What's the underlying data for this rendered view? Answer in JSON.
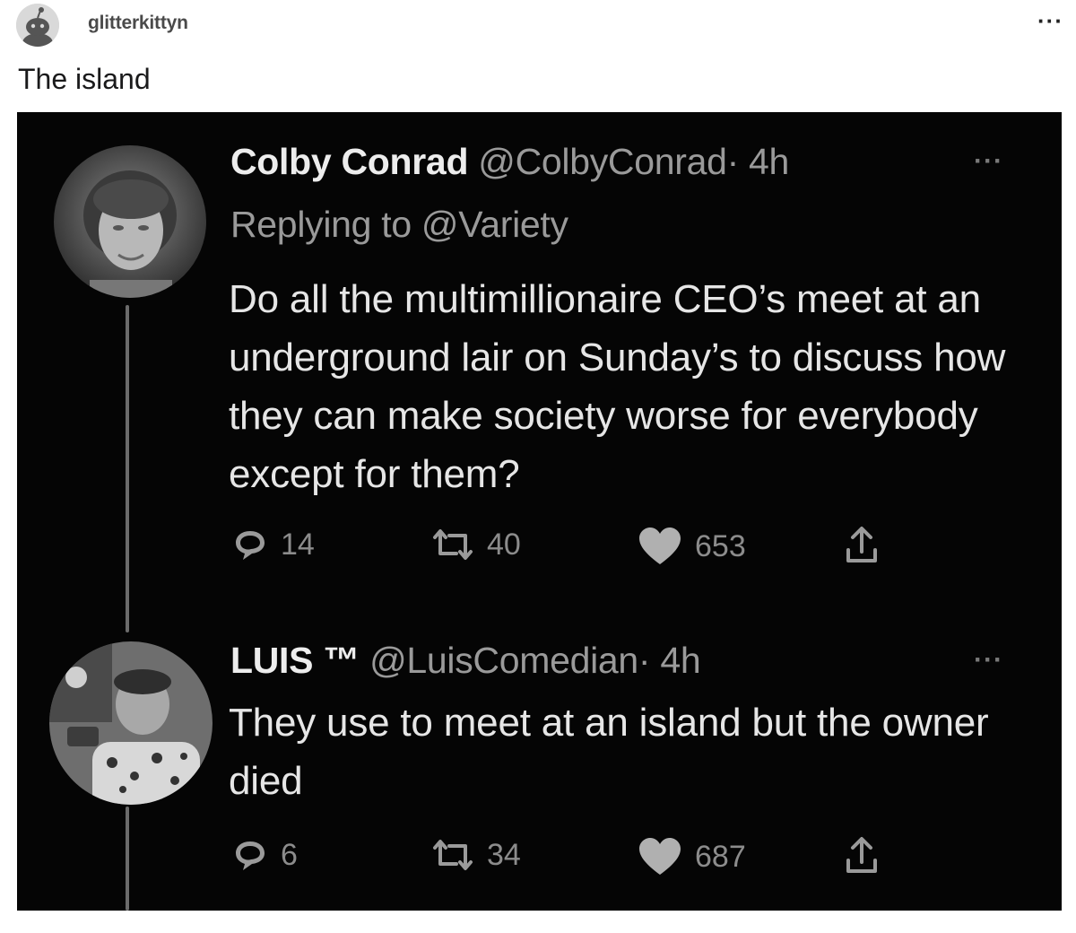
{
  "post": {
    "username": "glitterkittyn",
    "title": "The island",
    "more_icon": "more-horizontal-icon"
  },
  "tweets": [
    {
      "name": "Colby Conrad",
      "handle": "@ColbyConrad",
      "time": "· 4h",
      "replying_to": "Replying to @Variety",
      "body": "Do all the multimillionaire CEO’s meet at an underground lair on Sunday’s to discuss how they can make society worse for everybody except for them?",
      "replies": "14",
      "retweets": "40",
      "likes": "653"
    },
    {
      "name": "LUIS ™",
      "handle": "@LuisComedian",
      "time": "· 4h",
      "body": "They use to meet at an island but the owner died",
      "replies": "6",
      "retweets": "34",
      "likes": "687"
    }
  ],
  "colors": {
    "screenshot_bg": "#050505",
    "name_text": "#ededed",
    "meta_text": "#9a9a9a",
    "title_text": "#1a1a1b"
  }
}
